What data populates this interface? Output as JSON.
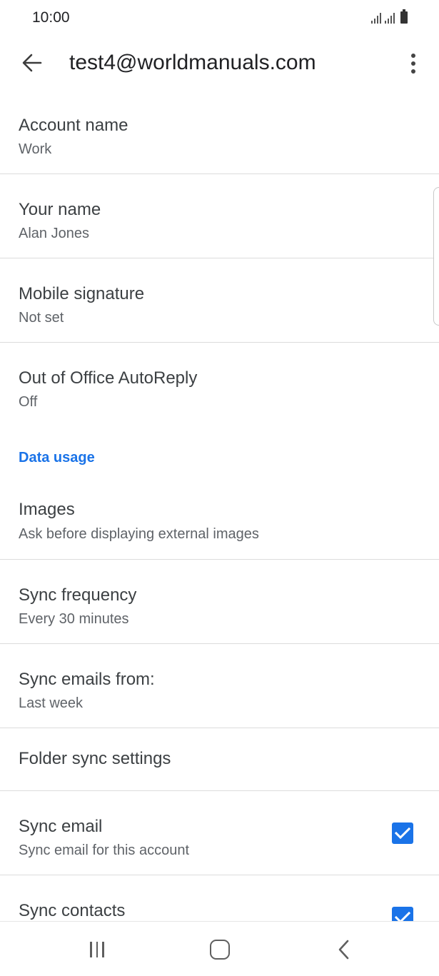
{
  "status_bar": {
    "time": "10:00"
  },
  "app_bar": {
    "title": "test4@worldmanuals.com"
  },
  "settings": {
    "account_name": {
      "title": "Account name",
      "value": "Work"
    },
    "your_name": {
      "title": "Your name",
      "value": "Alan Jones"
    },
    "mobile_signature": {
      "title": "Mobile signature",
      "value": "Not set"
    },
    "out_of_office": {
      "title": "Out of Office AutoReply",
      "value": "Off"
    },
    "data_usage_header": "Data usage",
    "images": {
      "title": "Images",
      "value": "Ask before displaying external images"
    },
    "sync_frequency": {
      "title": "Sync frequency",
      "value": "Every 30 minutes"
    },
    "sync_emails_from": {
      "title": "Sync emails from:",
      "value": "Last week"
    },
    "folder_sync": {
      "title": "Folder sync settings"
    },
    "sync_email": {
      "title": "Sync email",
      "value": "Sync email for this account",
      "checked": true
    },
    "sync_contacts": {
      "title": "Sync contacts",
      "checked": true
    }
  },
  "colors": {
    "accent": "#1a73e8",
    "divider": "#dcdcdc",
    "primary_text": "#3c4043",
    "secondary_text": "#5f6368"
  }
}
